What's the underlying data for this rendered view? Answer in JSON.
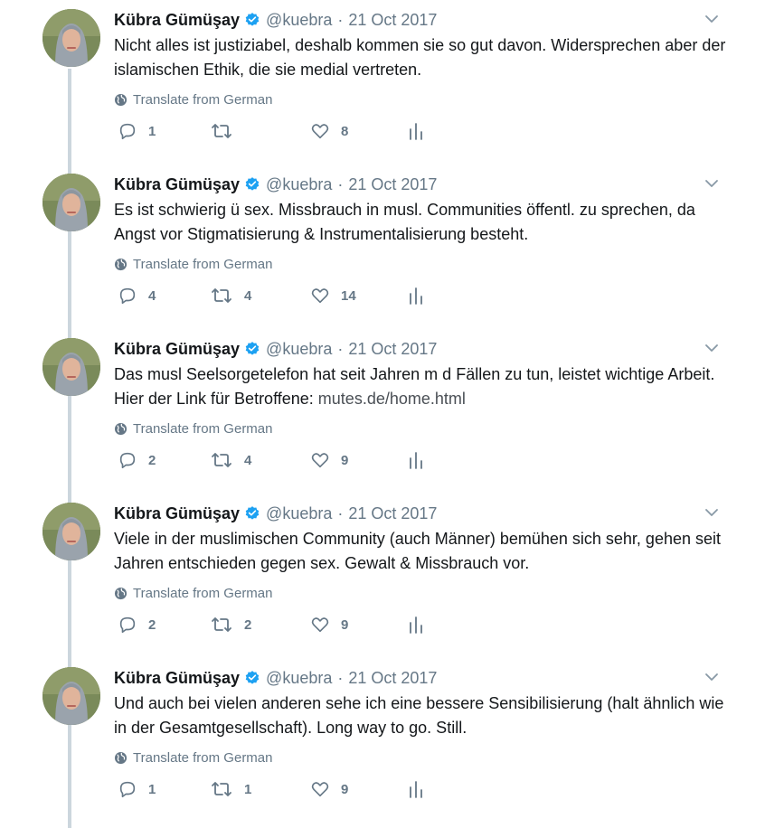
{
  "tweets": [
    {
      "author": "Kübra Gümüşay",
      "handle": "@kuebra",
      "separator": "·",
      "date": "21 Oct 2017",
      "text": "Nicht alles ist justiziabel, deshalb kommen sie so gut davon. Widersprechen aber der islamischen Ethik, die sie medial vertreten.",
      "link": "",
      "translate": "Translate from German",
      "replies": "1",
      "retweets": "",
      "likes": "8"
    },
    {
      "author": "Kübra Gümüşay",
      "handle": "@kuebra",
      "separator": "·",
      "date": "21 Oct 2017",
      "text": "Es ist schwierig ü sex. Missbrauch in musl. Communities öffentl. zu sprechen, da Angst vor Stigmatisierung & Instrumentalisierung besteht.",
      "link": "",
      "translate": "Translate from German",
      "replies": "4",
      "retweets": "4",
      "likes": "14"
    },
    {
      "author": "Kübra Gümüşay",
      "handle": "@kuebra",
      "separator": "·",
      "date": "21 Oct 2017",
      "text": "Das musl Seelsorgetelefon hat seit Jahren m d Fällen zu tun, leistet wichtige Arbeit. Hier der Link für Betroffene: ",
      "link": "mutes.de/home.html",
      "translate": "Translate from German",
      "replies": "2",
      "retweets": "4",
      "likes": "9"
    },
    {
      "author": "Kübra Gümüşay",
      "handle": "@kuebra",
      "separator": "·",
      "date": "21 Oct 2017",
      "text": "Viele in der muslimischen Community (auch Männer) bemühen sich sehr, gehen seit Jahren entschieden gegen sex. Gewalt & Missbrauch vor.",
      "link": "",
      "translate": "Translate from German",
      "replies": "2",
      "retweets": "2",
      "likes": "9"
    },
    {
      "author": "Kübra Gümüşay",
      "handle": "@kuebra",
      "separator": "·",
      "date": "21 Oct 2017",
      "text": "Und auch bei vielen anderen sehe ich eine bessere Sensibilisierung (halt ähnlich wie in der Gesamtgesellschaft). Long way to go. Still.",
      "link": "",
      "translate": "Translate from German",
      "replies": "1",
      "retweets": "1",
      "likes": "9"
    }
  ],
  "icons": {
    "verified": "verified-badge-icon",
    "caret": "chevron-down-icon",
    "globe": "globe-icon",
    "reply": "reply-icon",
    "retweet": "retweet-icon",
    "like": "heart-icon",
    "stats": "analytics-icon"
  },
  "colors": {
    "verified_blue": "#1da1f2",
    "secondary_text": "#657786",
    "thread_line": "#ccd6dd",
    "primary_text": "#14171a"
  }
}
